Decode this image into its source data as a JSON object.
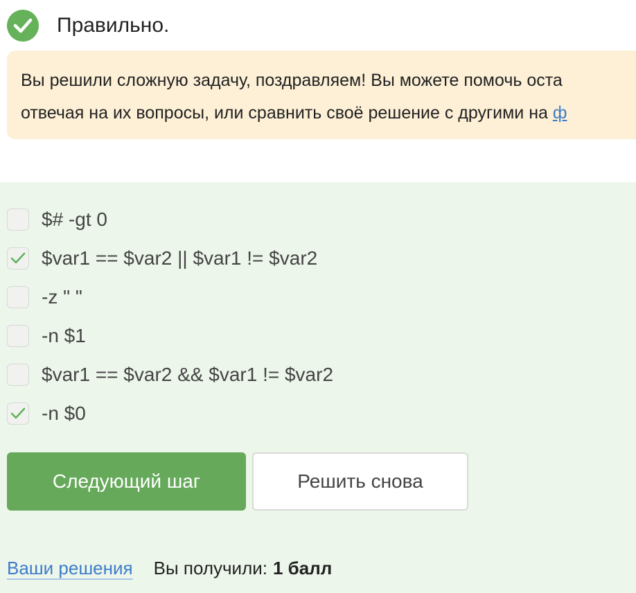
{
  "status": {
    "icon": "check-circle-icon",
    "text": "Правильно.",
    "color": "#66b25a"
  },
  "notice": {
    "line1": "Вы решили сложную задачу, поздравляем! Вы можете помочь оста",
    "line2_text": "отвечая на их вопросы, или сравнить своё решение с другими на ",
    "line2_link": "ф",
    "background": "#fdf0d6"
  },
  "options": [
    {
      "label": "$# -gt 0",
      "checked": false
    },
    {
      "label": "$var1 == $var2 || $var1 != $var2",
      "checked": true
    },
    {
      "label": "-z \" \"",
      "checked": false
    },
    {
      "label": "-n $1",
      "checked": false
    },
    {
      "label": "$var1 == $var2 && $var1 != $var2",
      "checked": false
    },
    {
      "label": "-n $0",
      "checked": true
    }
  ],
  "buttons": {
    "next_label": "Следующий шаг",
    "retry_label": "Решить снова"
  },
  "footer": {
    "solutions_link": "Ваши решения",
    "score_label": "Вы получили:",
    "score_value": "1 балл"
  },
  "colors": {
    "accent_green": "#66a95b",
    "answers_background": "#ecf6ea",
    "link_blue": "#3d7cc9"
  }
}
